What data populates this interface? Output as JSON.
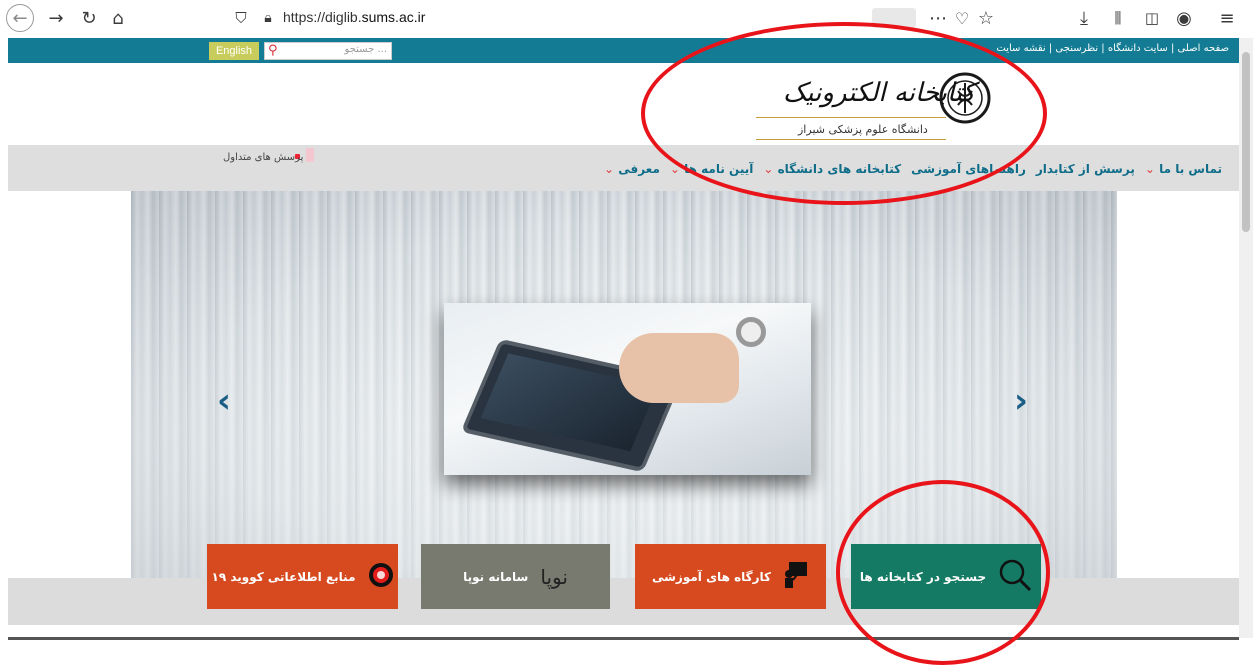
{
  "browser": {
    "url_prefix": "https://diglib.",
    "url_domain": "sums.ac.ir",
    "icons": [
      "back-icon",
      "forward-icon",
      "reload-icon",
      "home-icon",
      "shield-icon",
      "lock-icon",
      "more-icon",
      "pocket-icon",
      "star-icon",
      "download-icon",
      "library-icon",
      "sidebar-icon",
      "account-icon",
      "menu-icon"
    ]
  },
  "topbar": {
    "english_label": "English",
    "search_placeholder": "جستجو ...",
    "links": "صفحه اصلی | سایت دانشگاه | نظرسنجی | نقشه سایت"
  },
  "header": {
    "logo_title": "کتابخانه الکترونیک",
    "logo_subtitle": "دانشگاه علوم پزشکی شیراز"
  },
  "nav": {
    "faq_label": "پرسش های متداول",
    "items": [
      {
        "label": "معرفی",
        "chevron": true
      },
      {
        "label": "آیین نامه ها",
        "chevron": true
      },
      {
        "label": "کتابخانه های دانشگاه",
        "chevron": true
      },
      {
        "label": "راهنماهای آموزشی",
        "chevron": false
      },
      {
        "label": "پرسش از کتابدار",
        "chevron": false
      },
      {
        "label": "تماس با ما",
        "chevron": true
      }
    ]
  },
  "slider": {
    "prev_label": "‹",
    "next_label": "›"
  },
  "tiles": [
    {
      "label": "جستجو در کتابخانه ها",
      "color": "#157a63",
      "icon": "magnifier-icon"
    },
    {
      "label": "کارگاه های آموزشی",
      "color": "#d74a20",
      "icon": "teacher-board-icon"
    },
    {
      "label": "سامانه نوپا",
      "logo": "نوپا",
      "color": "#787a6f",
      "icon": "noopa-logo"
    },
    {
      "label": "منابع اطلاعاتی کووید ۱۹",
      "color": "#d74a20",
      "icon": "corona-virus-icon"
    }
  ],
  "annotations": {
    "color": "#e8141a"
  }
}
